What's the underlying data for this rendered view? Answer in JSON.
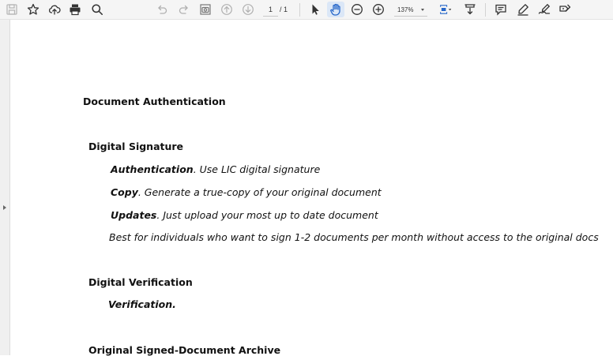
{
  "toolbar": {
    "buttons": [
      {
        "name": "save-icon",
        "label": "Save"
      },
      {
        "name": "star-icon",
        "label": "Bookmark"
      },
      {
        "name": "cloud-upload-icon",
        "label": "Upload"
      },
      {
        "name": "print-icon",
        "label": "Print"
      },
      {
        "name": "search-icon",
        "label": "Find"
      }
    ],
    "page_current": "1",
    "page_total": "/ 1",
    "zoom": "137%"
  },
  "document": {
    "title": "Document Authentication",
    "sections": [
      {
        "heading": "Digital Signature",
        "items": [
          {
            "bold": "Authentication",
            "text": ". Use LIC digital signature"
          },
          {
            "bold": "Copy",
            "text": ". Generate a true-copy of your original document"
          },
          {
            "bold": "Updates",
            "text": ". Just upload your most up to date document"
          }
        ],
        "note": "Best for individuals who want to sign 1-2 documents per month without access to the original docs"
      },
      {
        "heading": "Digital Verification",
        "items": [
          {
            "bold": "Verification.",
            "text": ""
          }
        ]
      },
      {
        "heading": "Original Signed-Document Archive"
      }
    ]
  }
}
